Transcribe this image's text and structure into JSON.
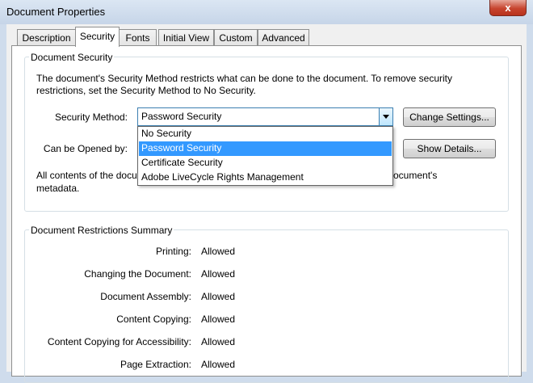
{
  "window": {
    "title": "Document Properties",
    "close_glyph": "x"
  },
  "tabs": [
    {
      "label": "Description"
    },
    {
      "label": "Security"
    },
    {
      "label": "Fonts"
    },
    {
      "label": "Initial View"
    },
    {
      "label": "Custom"
    },
    {
      "label": "Advanced"
    }
  ],
  "active_tab": "Security",
  "security": {
    "group_title": "Document Security",
    "description": "The document's Security Method restricts what can be done to the document. To remove security restrictions, set the Security Method to No Security.",
    "method_label": "Security Method:",
    "method_value": "Password Security",
    "change_settings_button": "Change Settings...",
    "opened_by_label": "Can be Opened by:",
    "show_details_button": "Show Details...",
    "contents_text_start": "All contents of the docu",
    "contents_text_end": "ocument's",
    "contents_text_line2": "metadata.",
    "dropdown_options": [
      "No Security",
      "Password Security",
      "Certificate Security",
      "Adobe LiveCycle Rights Management"
    ],
    "selected_option": "Password Security"
  },
  "restrictions": {
    "group_title": "Document Restrictions Summary",
    "rows": [
      {
        "label": "Printing:",
        "value": "Allowed"
      },
      {
        "label": "Changing the Document:",
        "value": "Allowed"
      },
      {
        "label": "Document Assembly:",
        "value": "Allowed"
      },
      {
        "label": "Content Copying:",
        "value": "Allowed"
      },
      {
        "label": "Content Copying for Accessibility:",
        "value": "Allowed"
      },
      {
        "label": "Page Extraction:",
        "value": "Allowed"
      }
    ]
  },
  "colors": {
    "title_bar": "#c6d5e8",
    "selection": "#3399ff",
    "close_button": "#c7452f"
  }
}
